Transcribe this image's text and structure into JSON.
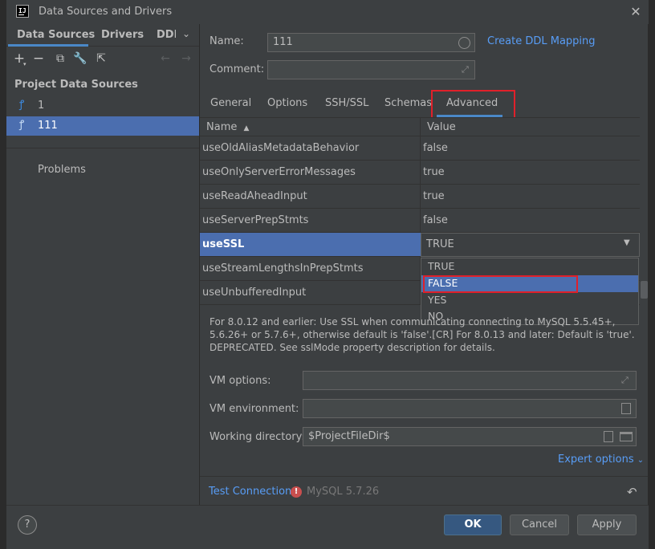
{
  "window": {
    "title": "Data Sources and Drivers",
    "app_icon_text": "IJ"
  },
  "left": {
    "tabs": [
      {
        "label": "Data Sources"
      },
      {
        "label": "Drivers"
      },
      {
        "label": "DDI"
      }
    ],
    "section_title": "Project Data Sources",
    "data_sources": [
      {
        "label": "1"
      },
      {
        "label": "111",
        "selected": true
      }
    ],
    "problems_label": "Problems"
  },
  "right": {
    "name_label": "Name:",
    "name_value": "111",
    "create_ddl_link": "Create DDL Mapping",
    "comment_label": "Comment:",
    "comment_value": "",
    "tabs": [
      {
        "label": "General"
      },
      {
        "label": "Options"
      },
      {
        "label": "SSH/SSL"
      },
      {
        "label": "Schemas"
      },
      {
        "label": "Advanced",
        "selected": true
      }
    ],
    "table": {
      "headers": {
        "name": "Name",
        "value": "Value"
      },
      "rows": [
        {
          "name": "useOldAliasMetadataBehavior",
          "value": "false"
        },
        {
          "name": "useOnlyServerErrorMessages",
          "value": "true"
        },
        {
          "name": "useReadAheadInput",
          "value": "true"
        },
        {
          "name": "useServerPrepStmts",
          "value": "false"
        },
        {
          "name": "useSSL",
          "value": "TRUE",
          "selected": true
        },
        {
          "name": "useStreamLengthsInPrepStmts",
          "value": ""
        },
        {
          "name": "useUnbufferedInput",
          "value": ""
        }
      ]
    },
    "dropdown_options": [
      {
        "label": "TRUE"
      },
      {
        "label": "FALSE",
        "selected": true
      },
      {
        "label": "YES"
      },
      {
        "label": "NO"
      }
    ],
    "description": "For 8.0.12 and earlier: Use SSL when communicating connecting to MySQL 5.5.45+, 5.6.26+ or 5.7.6+, otherwise default is 'false'.[CR] For 8.0.13 and later: Default is 'true'. DEPRECATED. See sslMode property description for details.",
    "vm_options_label": "VM options:",
    "vm_options_value": "",
    "vm_environment_label": "VM environment:",
    "vm_environment_value": "",
    "working_directory_label": "Working directory:",
    "working_directory_value": "$ProjectFileDir$",
    "expert_options_link": "Expert options",
    "test_connection_link": "Test Connection",
    "status_text": "MySQL 5.7.26"
  },
  "footer": {
    "help_label": "?",
    "ok_label": "OK",
    "cancel_label": "Cancel",
    "apply_label": "Apply"
  },
  "colors": {
    "accent": "#4a88c7",
    "selection": "#4b6eaf",
    "link": "#589df6",
    "highlight_box": "#e0202a",
    "background": "#3c3f41"
  }
}
